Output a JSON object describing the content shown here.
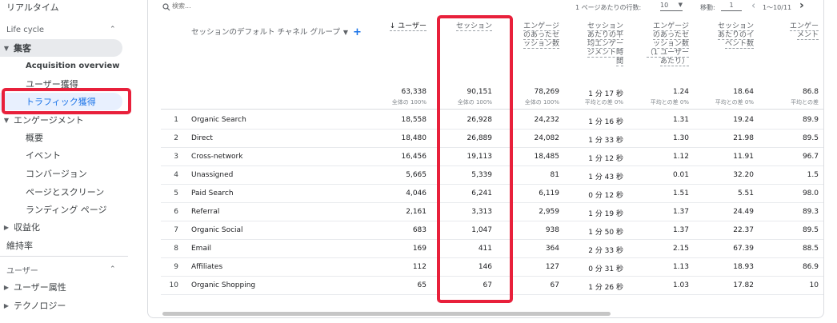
{
  "sidebar": {
    "realtime": "リアルタイム",
    "lifecycle": "Life cycle",
    "acquisition": "集客",
    "acq_overview": "Acquisition overview",
    "user_acq": "ユーザー獲得",
    "traffic_acq": "トラフィック獲得",
    "engagement": "エンゲージメント",
    "eng_overview": "概要",
    "events": "イベント",
    "conversions": "コンバージョン",
    "pages": "ページとスクリーン",
    "landing": "ランディング ページ",
    "monetization": "収益化",
    "retention": "維持率",
    "user_section": "ユーザー",
    "user_attr": "ユーザー属性",
    "tech": "テクノロジー"
  },
  "toolbar": {
    "search_placeholder": "検索...",
    "rows_label": "1 ページあたりの行数:",
    "rows_value": "10",
    "move_label": "移動:",
    "move_value": "1",
    "range": "1〜10/11"
  },
  "table": {
    "dimension_header": "セッションのデフォルト チャネル グループ",
    "columns": [
      {
        "label_lines": [
          "↓ ユーザー"
        ],
        "total": "63,338",
        "total_sub": "全体の 100%"
      },
      {
        "label_lines": [
          "セッション"
        ],
        "total": "90,151",
        "total_sub": "全体の 100%"
      },
      {
        "label_lines": [
          "エンゲージ",
          "のあったセ",
          "ッション数"
        ],
        "total": "78,269",
        "total_sub": "全体の 100%"
      },
      {
        "label_lines": [
          "セッション",
          "あたりの平",
          "均エンゲー",
          "ジメント時",
          "間"
        ],
        "total": "1 分 17 秒",
        "total_sub": "平均との差 0%"
      },
      {
        "label_lines": [
          "エンゲージ",
          "のあったセ",
          "ッション数",
          "（1 ユーザー",
          "あたり）"
        ],
        "total": "1.24",
        "total_sub": "平均との差 0%"
      },
      {
        "label_lines": [
          "セッション",
          "あたりのイ",
          "ベント数"
        ],
        "total": "18.64",
        "total_sub": "平均との差 0%"
      },
      {
        "label_lines": [
          "エンゲー",
          "メント"
        ],
        "total": "86.8",
        "total_sub": "平均との差"
      }
    ],
    "rows": [
      {
        "idx": "1",
        "name": "Organic Search",
        "cells": [
          "18,558",
          "26,928",
          "24,232",
          "1 分 16 秒",
          "1.31",
          "19.24",
          "89.9"
        ]
      },
      {
        "idx": "2",
        "name": "Direct",
        "cells": [
          "18,480",
          "26,889",
          "24,082",
          "1 分 33 秒",
          "1.30",
          "21.98",
          "89.5"
        ]
      },
      {
        "idx": "3",
        "name": "Cross-network",
        "cells": [
          "16,456",
          "19,113",
          "18,485",
          "1 分 12 秒",
          "1.12",
          "11.91",
          "96.7"
        ]
      },
      {
        "idx": "4",
        "name": "Unassigned",
        "cells": [
          "5,665",
          "5,339",
          "81",
          "1 分 43 秒",
          "0.01",
          "32.20",
          "1.5"
        ]
      },
      {
        "idx": "5",
        "name": "Paid Search",
        "cells": [
          "4,046",
          "6,241",
          "6,119",
          "0 分 12 秒",
          "1.51",
          "5.51",
          "98.0"
        ]
      },
      {
        "idx": "6",
        "name": "Referral",
        "cells": [
          "2,161",
          "3,313",
          "2,959",
          "1 分 19 秒",
          "1.37",
          "24.49",
          "89.3"
        ]
      },
      {
        "idx": "7",
        "name": "Organic Social",
        "cells": [
          "683",
          "1,047",
          "938",
          "1 分 50 秒",
          "1.37",
          "22.37",
          "89.5"
        ]
      },
      {
        "idx": "8",
        "name": "Email",
        "cells": [
          "169",
          "411",
          "364",
          "2 分 33 秒",
          "2.15",
          "67.39",
          "88.5"
        ]
      },
      {
        "idx": "9",
        "name": "Affiliates",
        "cells": [
          "112",
          "146",
          "127",
          "0 分 31 秒",
          "1.13",
          "18.93",
          "86.9"
        ]
      },
      {
        "idx": "10",
        "name": "Organic Shopping",
        "cells": [
          "65",
          "67",
          "67",
          "1 分 26 秒",
          "1.03",
          "17.82",
          "10"
        ]
      }
    ]
  },
  "colors": {
    "highlight": "#e8203b",
    "selected": "#1a73e8"
  }
}
